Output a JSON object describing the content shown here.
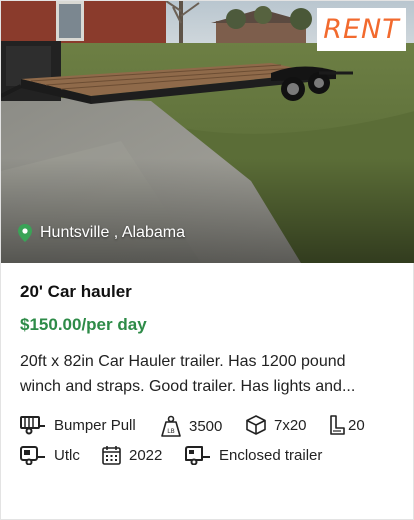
{
  "listing": {
    "badge": "RENT",
    "location": "Huntsville , Alabama",
    "title": "20' Car hauler",
    "price": "$150.00/per day",
    "description": "20ft x 82in Car Hauler trailer. Has 1200 pound winch and straps. Good trailer. Has lights and..."
  },
  "specs": {
    "hitch": {
      "icon": "hitch-trailer-icon",
      "value": "Bumper Pull"
    },
    "weight": {
      "icon": "weight-lb-icon",
      "value": "3500"
    },
    "size": {
      "icon": "box-dimensions-icon",
      "value": "7x20"
    },
    "length": {
      "icon": "length-icon",
      "value": "20"
    },
    "make": {
      "icon": "trailer-make-icon",
      "value": "Utlc"
    },
    "year": {
      "icon": "calendar-icon",
      "value": "2022"
    },
    "type": {
      "icon": "enclosed-trailer-icon",
      "value": "Enclosed trailer"
    }
  },
  "colors": {
    "price": "#2e8b48",
    "badge_text": "#f26a2e",
    "location_pin": "#3aa357"
  }
}
